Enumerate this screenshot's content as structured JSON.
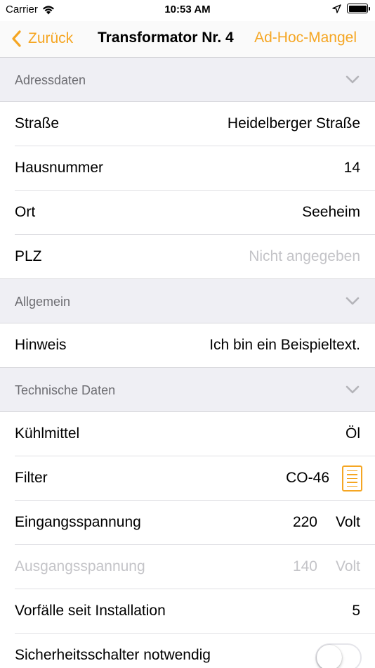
{
  "status_bar": {
    "carrier": "Carrier",
    "time": "10:53 AM"
  },
  "nav": {
    "back_label": "Zurück",
    "title": "Transformator Nr. 4",
    "action_label": "Ad-Hoc-Mangel"
  },
  "sections": {
    "address": {
      "title": "Adressdaten",
      "rows": [
        {
          "label": "Straße",
          "value": "Heidelberger Straße"
        },
        {
          "label": "Hausnummer",
          "value": "14"
        },
        {
          "label": "Ort",
          "value": "Seeheim"
        },
        {
          "label": "PLZ",
          "value": "Nicht angegeben"
        }
      ]
    },
    "general": {
      "title": "Allgemein",
      "rows": [
        {
          "label": "Hinweis",
          "value": "Ich bin ein Beispieltext."
        }
      ]
    },
    "technical": {
      "title": "Technische Daten",
      "coolant": {
        "label": "Kühlmittel",
        "value": "Öl"
      },
      "filter": {
        "label": "Filter",
        "value": "CO-46"
      },
      "input_voltage": {
        "label": "Eingangsspannung",
        "value": "220",
        "unit": "Volt"
      },
      "output_voltage": {
        "label": "Ausgangsspannung",
        "value": "140",
        "unit": "Volt"
      },
      "incidents": {
        "label": "Vorfälle seit Installation",
        "value": "5"
      },
      "safety_switch": {
        "label": "Sicherheitsschalter notwendig",
        "on": false
      }
    }
  },
  "colors": {
    "accent": "#f5a623",
    "section_bg": "#efeff4",
    "placeholder": "#c4c4c8"
  },
  "icons": {
    "back": "chevron-left-icon",
    "collapse": "chevron-down-icon",
    "filter_list": "list-icon",
    "wifi": "wifi-icon",
    "location": "location-arrow-icon",
    "battery": "battery-icon"
  }
}
